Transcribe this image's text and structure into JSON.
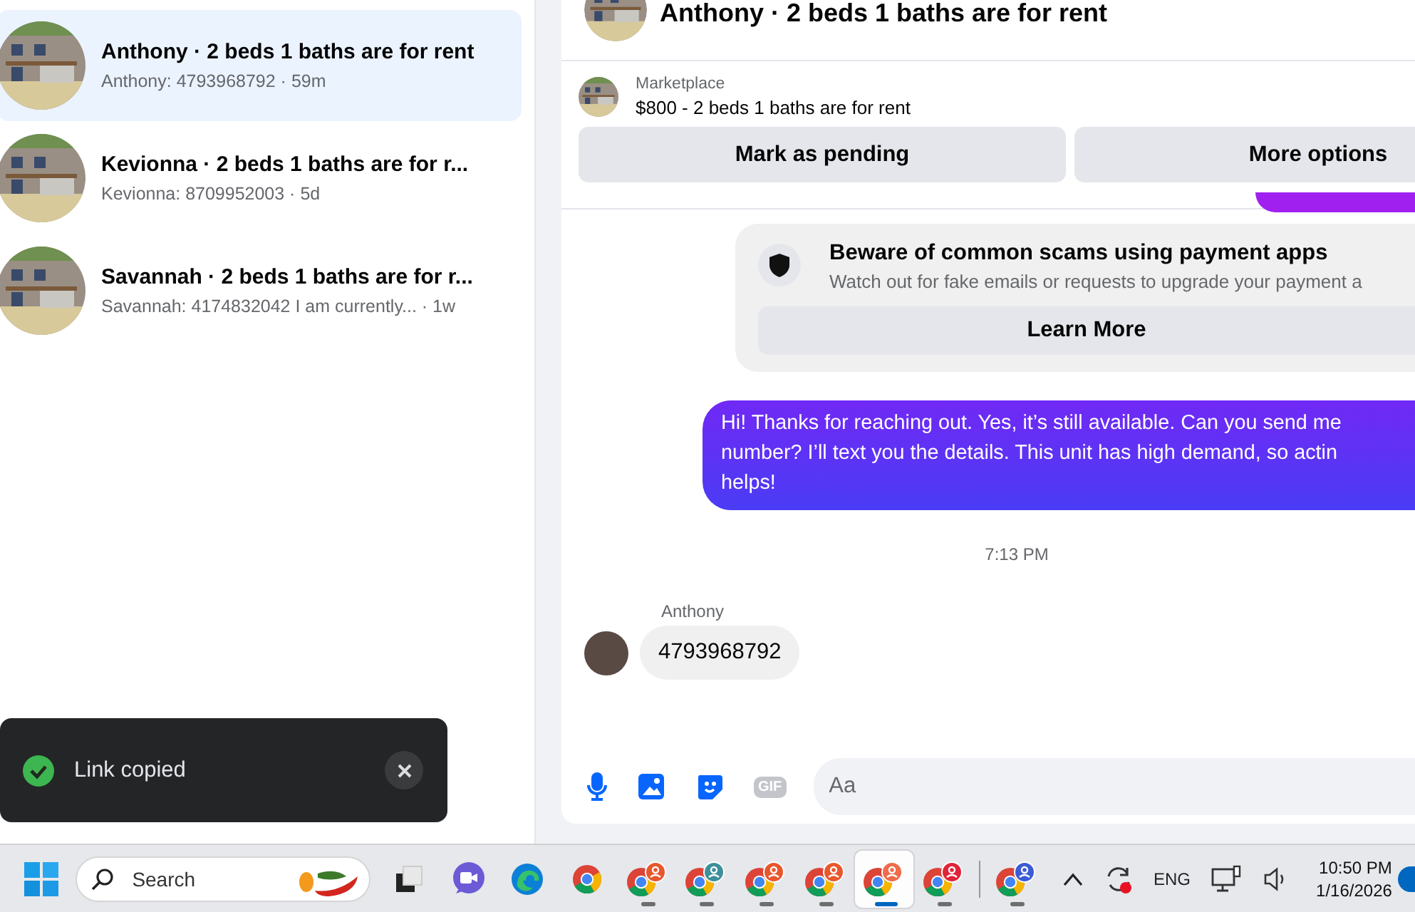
{
  "conversations": [
    {
      "title": "Anthony · 2 beds 1 baths are for rent",
      "preview": "Anthony: 4793968792 · 59m",
      "selected": true
    },
    {
      "title": "Kevionna · 2 beds 1 baths are for r...",
      "preview": "Kevionna: 8709952003 · 5d",
      "selected": false
    },
    {
      "title": "Savannah · 2 beds 1 baths are for r...",
      "preview": "Savannah: 4174832042 I am currently... · 1w",
      "selected": false
    }
  ],
  "chat": {
    "title": "Anthony · 2 beds 1 baths are for rent",
    "listing": {
      "label": "Marketplace",
      "title": "$800 - 2 beds 1 baths are for rent",
      "buttons": [
        "Mark as pending",
        "More options"
      ]
    },
    "notice": {
      "title": "Beware of common scams using payment apps",
      "text": "Watch out for fake emails or requests to upgrade your payment a",
      "button": "Learn More"
    },
    "outgoing": {
      "lines": [
        "Hi! Thanks for reaching out. Yes, it’s still available. Can you send me",
        "number? I’ll text you the details. This unit has high demand, so actin",
        "helps!"
      ]
    },
    "timestamp": "7:13 PM",
    "incoming": {
      "sender": "Anthony",
      "text": "4793968792"
    },
    "composer": {
      "gif_label": "GIF",
      "placeholder": "Aa"
    }
  },
  "toast": {
    "text": "Link copied"
  },
  "taskbar": {
    "search_placeholder": "Search",
    "apps": [
      {
        "kind": "taskview",
        "running": false,
        "selected": false
      },
      {
        "kind": "teams",
        "running": false,
        "selected": false
      },
      {
        "kind": "edge",
        "running": false,
        "selected": false
      },
      {
        "kind": "chrome",
        "running": false,
        "selected": false
      },
      {
        "kind": "profile",
        "color": "#e8572c",
        "running": true,
        "selected": false
      },
      {
        "kind": "profile",
        "color": "#3d8f9a",
        "running": true,
        "selected": false
      },
      {
        "kind": "profile",
        "color": "#e8572c",
        "running": true,
        "selected": false
      },
      {
        "kind": "profile",
        "color": "#e8572c",
        "running": true,
        "selected": false
      },
      {
        "kind": "profile",
        "color": "#ef6b4a",
        "running": true,
        "selected": true
      },
      {
        "kind": "profile",
        "color": "#e0243a",
        "running": true,
        "selected": false
      },
      {
        "kind": "profile",
        "color": "#3b5bd6",
        "separator_before": true,
        "running": true,
        "selected": false
      }
    ],
    "language": "ENG",
    "time": "10:50 PM",
    "date": "1/16/2026"
  }
}
